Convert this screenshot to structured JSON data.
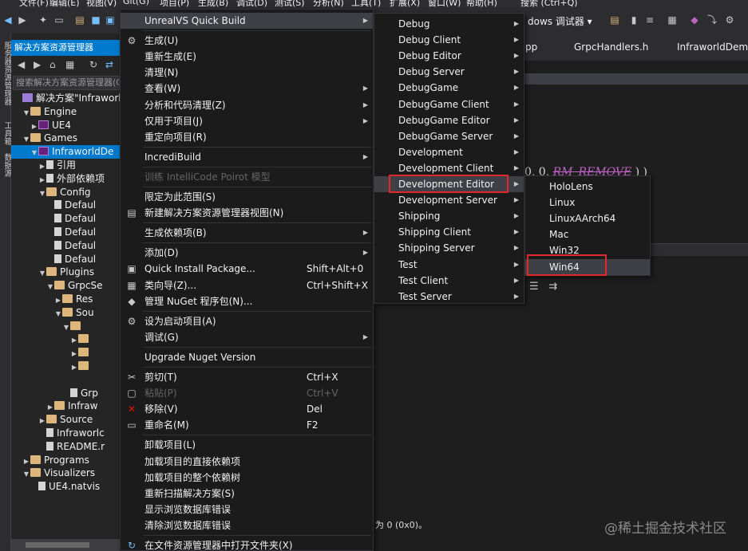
{
  "menubar": {
    "items": [
      "文件(F)",
      "编辑(E)",
      "视图(V)",
      "Git(G)",
      "项目(P)",
      "生成(B)",
      "调试(D)",
      "测试(S)",
      "分析(N)",
      "工具(T)",
      "扩展(X)",
      "窗口(W)",
      "帮助(H)",
      "搜索 (Ctrl+Q)"
    ]
  },
  "toolbar": {
    "platform_text": "dows 调试器 ▾"
  },
  "vertical_strip": {
    "labels": [
      "服务器资源管理器",
      "工具箱",
      "数据源"
    ]
  },
  "solution_explorer": {
    "title": "解决方案资源管理器",
    "search_placeholder": "搜索解决方案资源管理器(C",
    "tree": [
      {
        "label": "解决方案\"Infraworld",
        "depth": 0,
        "arrow": "",
        "icon": "solution"
      },
      {
        "label": "Engine",
        "depth": 1,
        "arrow": "▼",
        "icon": "folder"
      },
      {
        "label": "UE4",
        "depth": 2,
        "arrow": "▶",
        "icon": "project"
      },
      {
        "label": "Games",
        "depth": 1,
        "arrow": "▼",
        "icon": "folder"
      },
      {
        "label": "InfraworldDe",
        "depth": 2,
        "arrow": "▼",
        "icon": "project",
        "selected": true
      },
      {
        "label": "引用",
        "depth": 3,
        "arrow": "▶",
        "icon": "file"
      },
      {
        "label": "外部依赖项",
        "depth": 3,
        "arrow": "▶",
        "icon": "file"
      },
      {
        "label": "Config",
        "depth": 3,
        "arrow": "▼",
        "icon": "folder"
      },
      {
        "label": "Defaul",
        "depth": 4,
        "arrow": "",
        "icon": "file"
      },
      {
        "label": "Defaul",
        "depth": 4,
        "arrow": "",
        "icon": "file"
      },
      {
        "label": "Defaul",
        "depth": 4,
        "arrow": "",
        "icon": "file"
      },
      {
        "label": "Defaul",
        "depth": 4,
        "arrow": "",
        "icon": "file"
      },
      {
        "label": "Defaul",
        "depth": 4,
        "arrow": "",
        "icon": "file"
      },
      {
        "label": "Plugins",
        "depth": 3,
        "arrow": "▼",
        "icon": "folder"
      },
      {
        "label": "GrpcSe",
        "depth": 4,
        "arrow": "▼",
        "icon": "folder"
      },
      {
        "label": "Res",
        "depth": 5,
        "arrow": "▶",
        "icon": "folder"
      },
      {
        "label": "Sou",
        "depth": 5,
        "arrow": "▼",
        "icon": "folder"
      },
      {
        "label": "",
        "depth": 6,
        "arrow": "▼",
        "icon": "folder"
      },
      {
        "label": "",
        "depth": 7,
        "arrow": "▶",
        "icon": "folder"
      },
      {
        "label": "",
        "depth": 7,
        "arrow": "▶",
        "icon": "folder"
      },
      {
        "label": "",
        "depth": 7,
        "arrow": "▶",
        "icon": "folder"
      },
      {
        "label": "",
        "depth": 0,
        "arrow": "",
        "icon": ""
      },
      {
        "label": "Grp",
        "depth": 6,
        "arrow": "",
        "icon": "file"
      },
      {
        "label": "Infraw",
        "depth": 4,
        "arrow": "▶",
        "icon": "folder"
      },
      {
        "label": "Source",
        "depth": 3,
        "arrow": "▶",
        "icon": "folder"
      },
      {
        "label": "Infraworlc",
        "depth": 3,
        "arrow": "",
        "icon": "file"
      },
      {
        "label": "README.r",
        "depth": 3,
        "arrow": "",
        "icon": "file"
      },
      {
        "label": "Programs",
        "depth": 1,
        "arrow": "▶",
        "icon": "folder"
      },
      {
        "label": "Visualizers",
        "depth": 1,
        "arrow": "▼",
        "icon": "folder"
      },
      {
        "label": "UE4.natvis",
        "depth": 2,
        "arrow": "",
        "icon": "file"
      }
    ]
  },
  "editor": {
    "tabs": [
      "pp",
      "GrpcHandlers.h",
      "InfraworldDemo."
    ],
    "code_prefix": "0, 0, ",
    "code_keyword": "RM_REMOVE",
    "code_suffix": ") )",
    "output_text": "为 0 (0x0)。"
  },
  "watermark": "@稀土掘金技术社区",
  "context_menu": {
    "items": [
      {
        "label": "UnrealVS Quick Build",
        "submenu": true,
        "highlight": true,
        "icon": ""
      },
      {
        "sep": true
      },
      {
        "label": "生成(U)",
        "icon": "build"
      },
      {
        "label": "重新生成(E)",
        "icon": ""
      },
      {
        "label": "清理(N)",
        "icon": ""
      },
      {
        "label": "查看(W)",
        "submenu": true,
        "icon": ""
      },
      {
        "label": "分析和代码清理(Z)",
        "submenu": true,
        "icon": ""
      },
      {
        "label": "仅用于项目(J)",
        "submenu": true,
        "icon": ""
      },
      {
        "label": "重定向项目(R)",
        "icon": ""
      },
      {
        "sep": true
      },
      {
        "label": "IncrediBuild",
        "submenu": true,
        "icon": ""
      },
      {
        "sep": true
      },
      {
        "label": "训练 IntelliCode Poirot 模型",
        "disabled": true,
        "icon": ""
      },
      {
        "sep": true
      },
      {
        "label": "限定为此范围(S)",
        "icon": ""
      },
      {
        "label": "新建解决方案资源管理器视图(N)",
        "icon": "view"
      },
      {
        "sep": true
      },
      {
        "label": "生成依赖项(B)",
        "submenu": true,
        "icon": ""
      },
      {
        "sep": true
      },
      {
        "label": "添加(D)",
        "submenu": true,
        "icon": ""
      },
      {
        "label": "Quick Install Package...",
        "shortcut": "Shift+Alt+0",
        "icon": "package"
      },
      {
        "label": "类向导(Z)...",
        "shortcut": "Ctrl+Shift+X",
        "icon": "wizard"
      },
      {
        "label": "管理 NuGet 程序包(N)...",
        "icon": "nuget"
      },
      {
        "sep": true
      },
      {
        "label": "设为启动项目(A)",
        "icon": "gear"
      },
      {
        "label": "调试(G)",
        "submenu": true,
        "icon": ""
      },
      {
        "sep": true
      },
      {
        "label": "Upgrade Nuget Version",
        "icon": "upgrade"
      },
      {
        "sep": true
      },
      {
        "label": "剪切(T)",
        "shortcut": "Ctrl+X",
        "icon": "cut"
      },
      {
        "label": "粘贴(P)",
        "shortcut": "Ctrl+V",
        "disabled": true,
        "icon": "paste"
      },
      {
        "label": "移除(V)",
        "shortcut": "Del",
        "icon": "remove"
      },
      {
        "label": "重命名(M)",
        "shortcut": "F2",
        "icon": "rename"
      },
      {
        "sep": true
      },
      {
        "label": "卸载项目(L)",
        "icon": ""
      },
      {
        "label": "加载项目的直接依赖项",
        "icon": ""
      },
      {
        "label": "加载项目的整个依赖树",
        "icon": ""
      },
      {
        "label": "重新扫描解决方案(S)",
        "icon": ""
      },
      {
        "label": "显示浏览数据库错误",
        "icon": ""
      },
      {
        "label": "清除浏览数据库错误",
        "icon": ""
      },
      {
        "sep": true
      },
      {
        "label": "在文件资源管理器中打开文件夹(X)",
        "icon": "open"
      }
    ]
  },
  "build_menu": {
    "items": [
      "Debug",
      "Debug Client",
      "Debug Editor",
      "Debug Server",
      "DebugGame",
      "DebugGame Client",
      "DebugGame Editor",
      "DebugGame Server",
      "Development",
      "Development Client",
      "Development Editor",
      "Development Server",
      "Shipping",
      "Shipping Client",
      "Shipping Server",
      "Test",
      "Test Client",
      "Test Server"
    ],
    "highlighted": "Development Editor"
  },
  "platform_menu": {
    "items": [
      "HoloLens",
      "Linux",
      "LinuxAArch64",
      "Mac",
      "Win32",
      "Win64"
    ],
    "highlighted": "Win64"
  },
  "colors": {
    "accent": "#007acc",
    "menu_bg": "#1b1b1c",
    "highlight": "#3f3f46",
    "annotation_box": "#e0282e"
  }
}
